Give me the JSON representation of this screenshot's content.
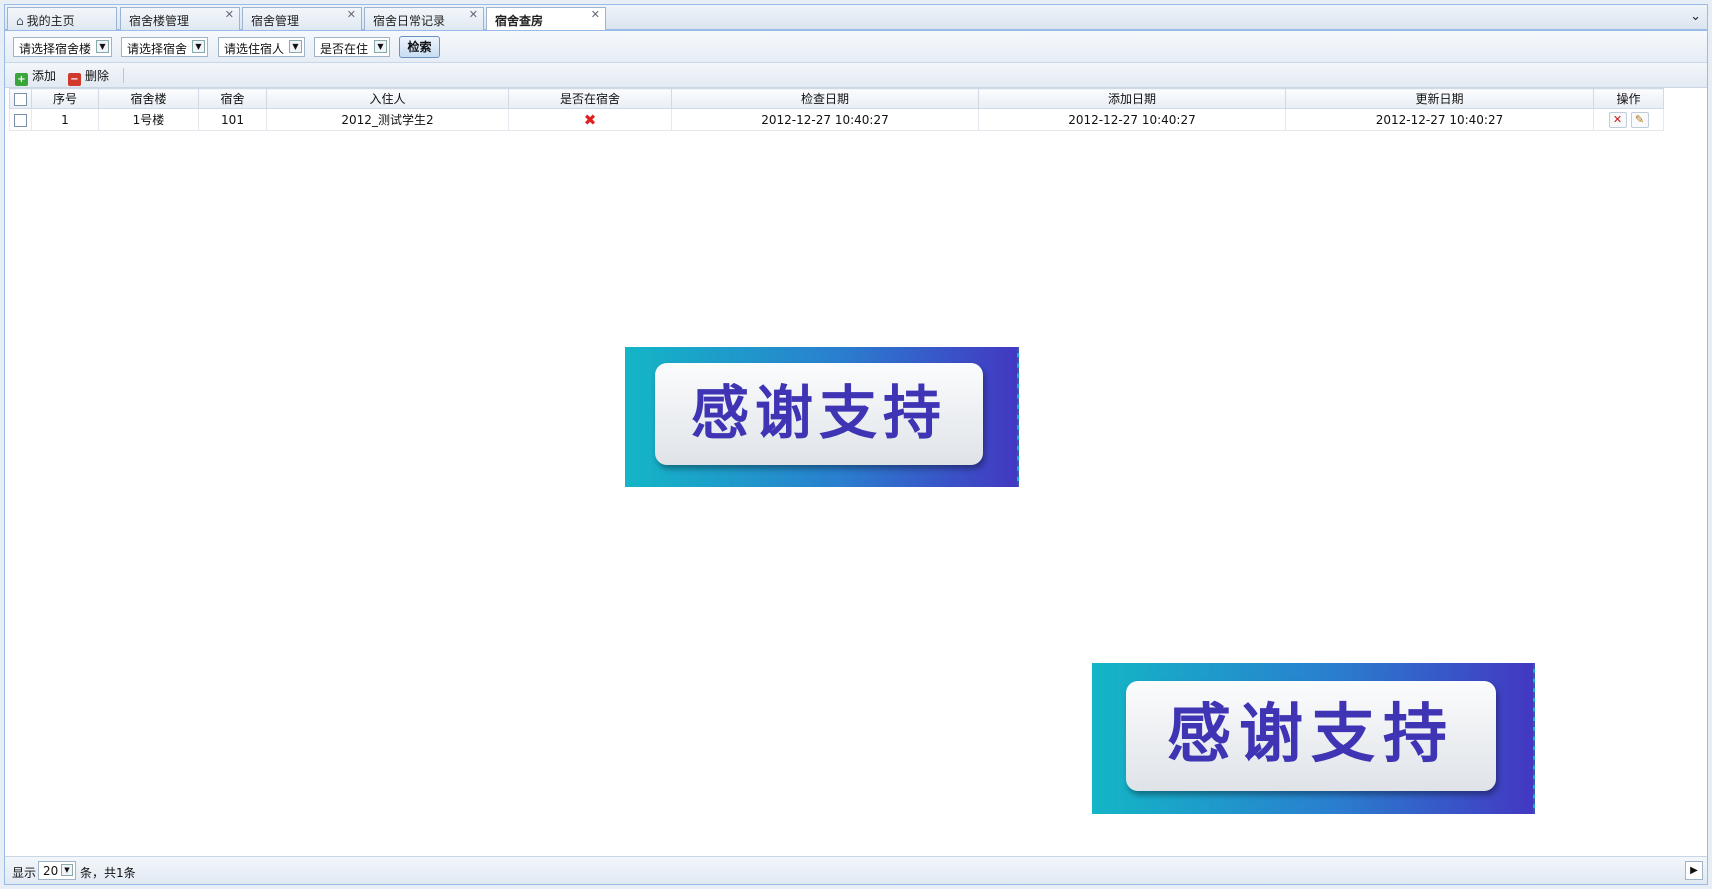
{
  "tabs": [
    {
      "label": "我的主页",
      "closable": false,
      "active": false
    },
    {
      "label": "宿舍楼管理",
      "closable": true,
      "active": false
    },
    {
      "label": "宿舍管理",
      "closable": true,
      "active": false
    },
    {
      "label": "宿舍日常记录",
      "closable": true,
      "active": false
    },
    {
      "label": "宿舍查房",
      "closable": true,
      "active": true
    }
  ],
  "filters": {
    "building": "请选择宿舍楼",
    "dorm": "请选择宿舍",
    "resident": "请选住宿人",
    "in_dorm": "是否在住",
    "search_label": "检索"
  },
  "toolbar": {
    "add_label": "添加",
    "delete_label": "删除"
  },
  "table": {
    "columns": [
      "序号",
      "宿舍楼",
      "宿舍",
      "入住人",
      "是否在宿舍",
      "检查日期",
      "添加日期",
      "更新日期",
      "操作"
    ],
    "rows": [
      {
        "index": "1",
        "building": "1号楼",
        "dorm": "101",
        "resident": "2012_测试学生2",
        "in_dorm": false,
        "check_date": "2012-12-27 10:40:27",
        "add_date": "2012-12-27 10:40:27",
        "update_date": "2012-12-27 10:40:27"
      }
    ]
  },
  "pager": {
    "show_label": "显示",
    "page_size": "20",
    "summary": "条，共1条"
  },
  "overlay": {
    "text": "感谢支持"
  },
  "colors": {
    "header_border": "#99bbe8",
    "banner_start": "#13b6c6",
    "banner_end": "#4338c2",
    "banner_text": "#3e34b4",
    "delete_red": "#e02020"
  },
  "icons": {
    "home": "home-icon",
    "add": "add-icon",
    "delete": "delete-icon",
    "edit": "edit-icon",
    "close": "close-icon",
    "x_mark": "x-mark-icon"
  }
}
